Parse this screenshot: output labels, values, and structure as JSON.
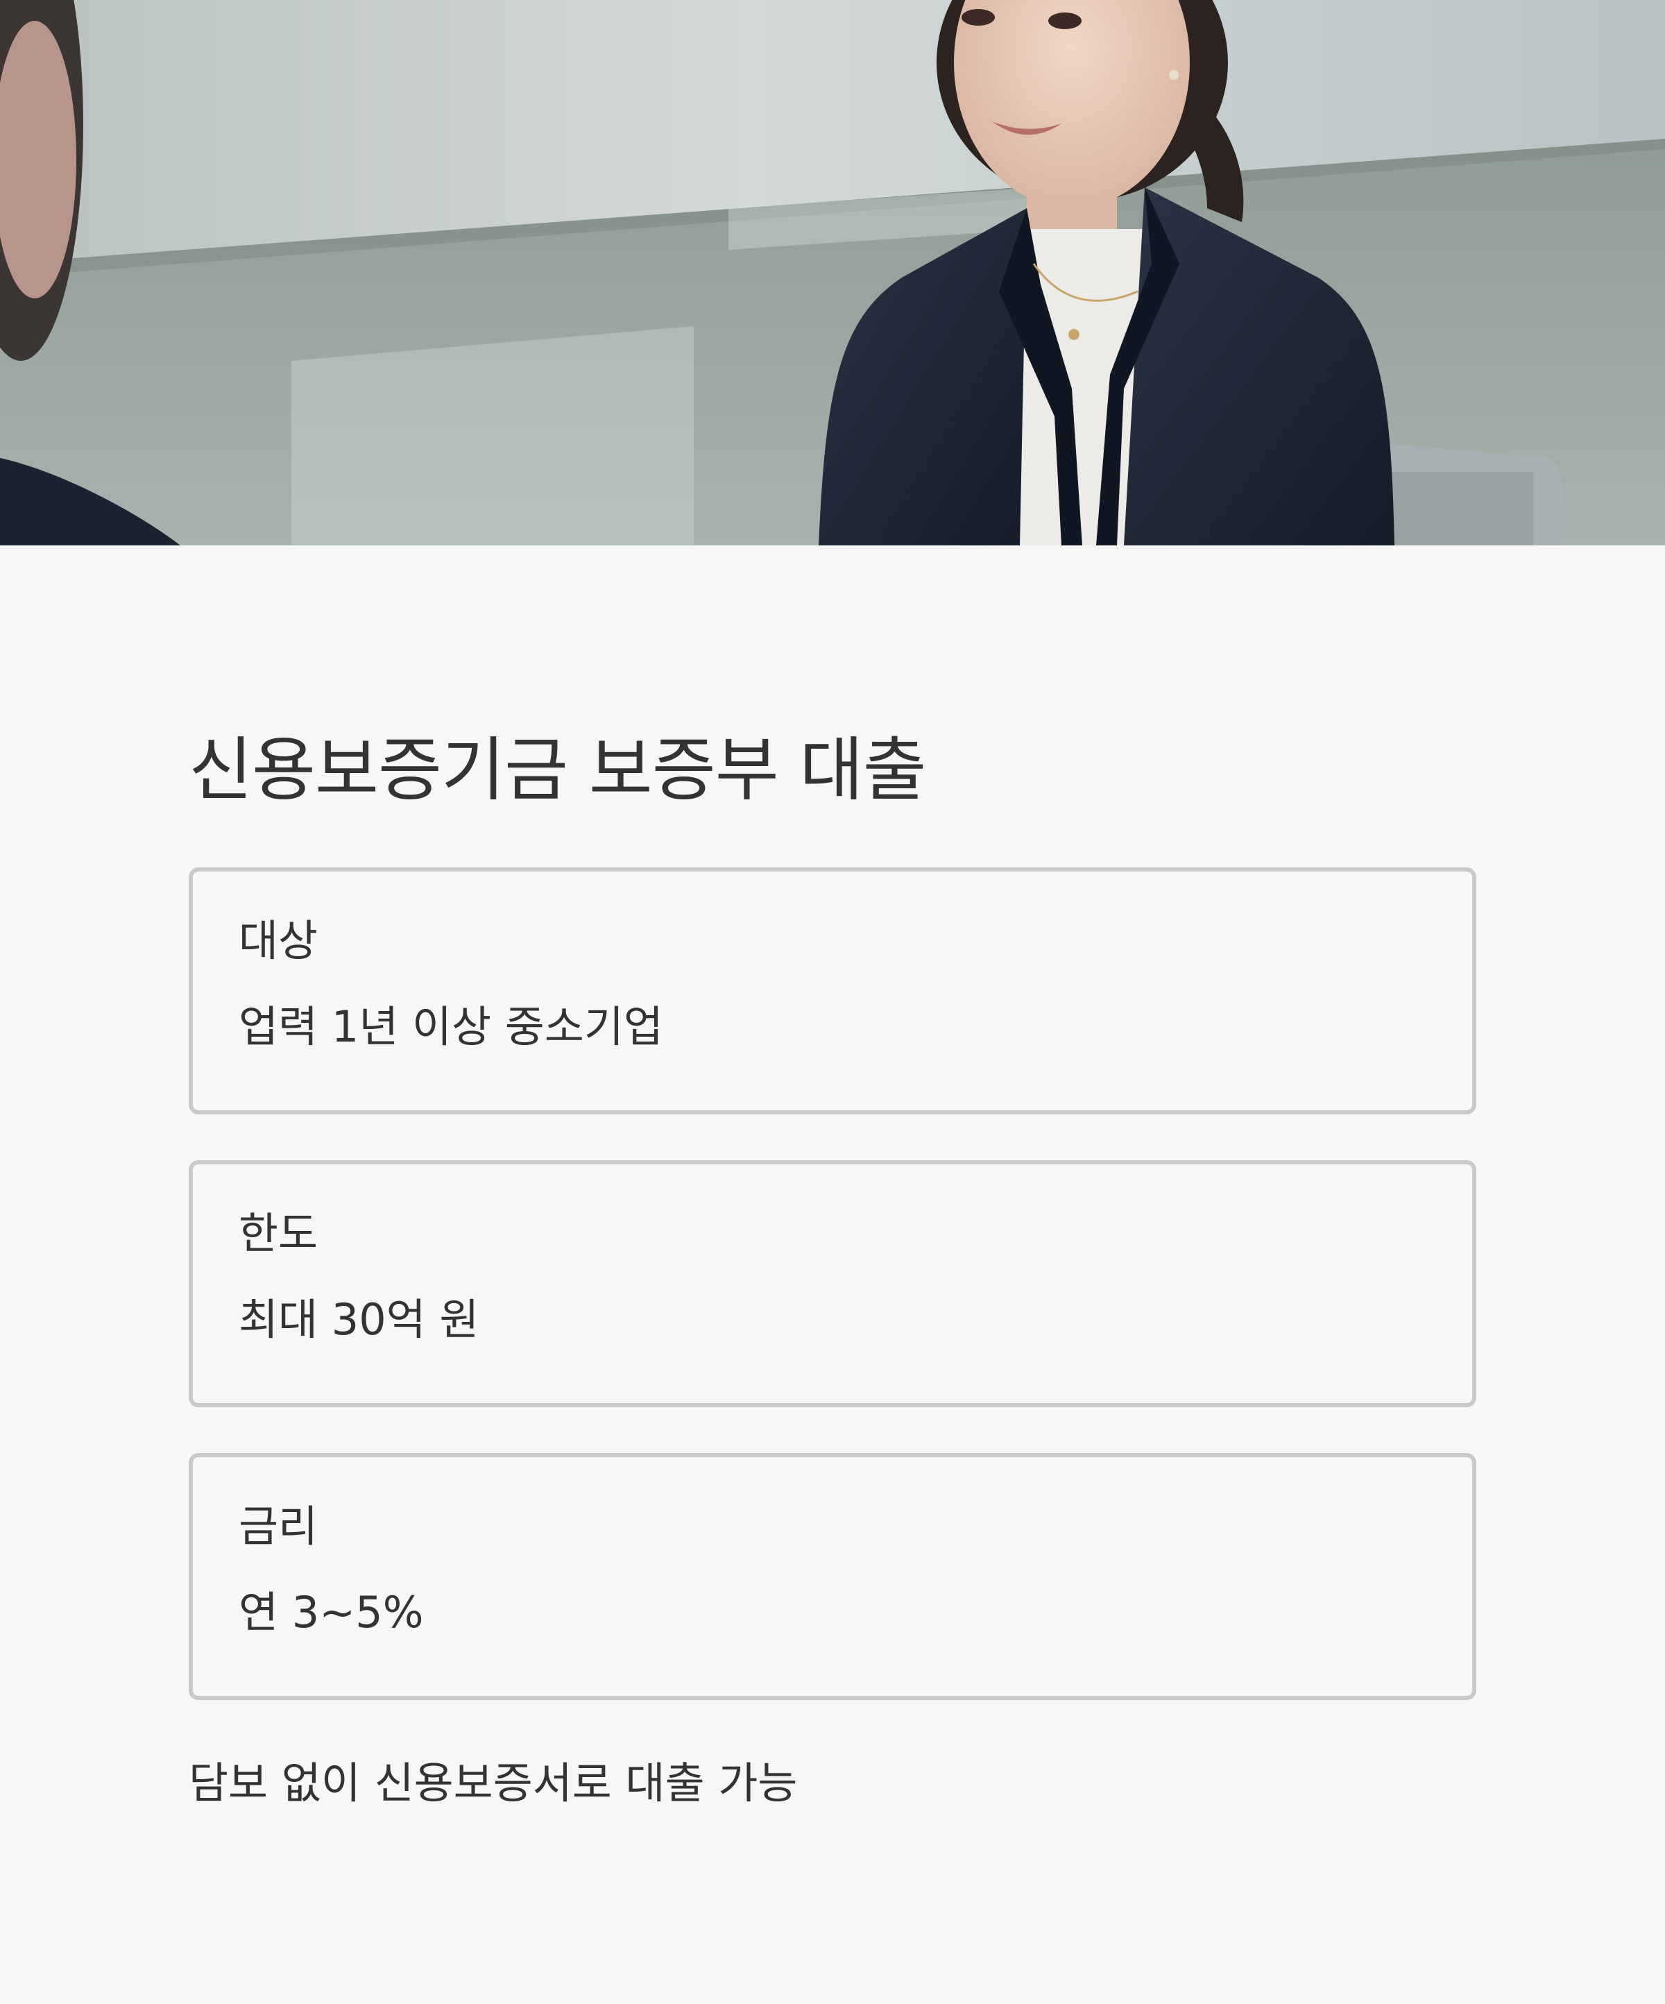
{
  "hero": {
    "image_alt": "business-consultation-photo"
  },
  "page": {
    "title": "신용보증기금 보증부 대출"
  },
  "cards": [
    {
      "label": "대상",
      "value": "업력 1년 이상 중소기업"
    },
    {
      "label": "한도",
      "value": "최대 30억 원"
    },
    {
      "label": "금리",
      "value": "연 3~5%"
    }
  ],
  "footnote": "담보 없이 신용보증서로 대출 가능",
  "colors": {
    "background": "#f7f7f7",
    "text": "#333333",
    "card_border": "#c9c9c9"
  }
}
